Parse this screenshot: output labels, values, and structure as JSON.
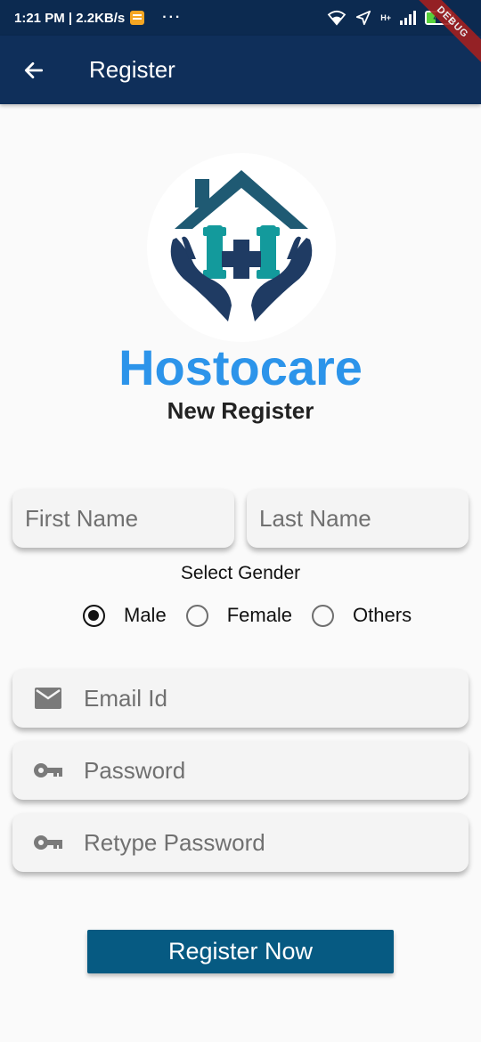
{
  "status_bar": {
    "time_info": "1:21 PM | 2.2KB/s",
    "more": "···",
    "network_type": "H+",
    "battery_level": "40",
    "debug_label": "DEBUG"
  },
  "app_bar": {
    "title": "Register"
  },
  "brand": {
    "name": "Hostocare",
    "subtitle": "New Register"
  },
  "form": {
    "first_name_placeholder": "First Name",
    "last_name_placeholder": "Last Name",
    "gender_label": "Select Gender",
    "gender_options": [
      "Male",
      "Female",
      "Others"
    ],
    "gender_selected": "Male",
    "email_placeholder": "Email Id",
    "password_placeholder": "Password",
    "retype_password_placeholder": "Retype Password",
    "submit_label": "Register Now"
  },
  "colors": {
    "app_bar": "#0f2f5a",
    "brand_text": "#2c94ea",
    "button": "#065a82",
    "logo_navy": "#1f3b63",
    "logo_teal": "#139a9c"
  }
}
